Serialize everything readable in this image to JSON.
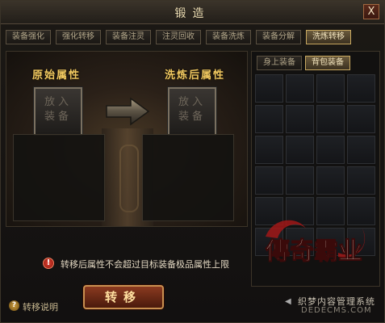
{
  "window": {
    "title": "锻造",
    "close_label": "X"
  },
  "tabs": [
    {
      "label": "装备强化",
      "active": false
    },
    {
      "label": "强化转移",
      "active": false
    },
    {
      "label": "装备注灵",
      "active": false
    },
    {
      "label": "注灵回收",
      "active": false
    },
    {
      "label": "装备洗炼",
      "active": false
    },
    {
      "label": "装备分解",
      "active": false
    },
    {
      "label": "洗炼转移",
      "active": true
    }
  ],
  "left_panel": {
    "orig_label": "原始属性",
    "after_label": "洗炼后属性",
    "orig_slot_text": "放入装备",
    "after_slot_text": "放入装备"
  },
  "right_panel": {
    "subtabs": [
      {
        "label": "身上装备",
        "active": false
      },
      {
        "label": "背包装备",
        "active": true
      }
    ],
    "grid_cells": 24
  },
  "notice": {
    "icon": "!",
    "text": "转移后属性不会超过目标装备极品属性上限"
  },
  "help": {
    "icon": "?",
    "label": "转移说明"
  },
  "transfer_button": "转移",
  "logo": {
    "text": "傳奇霸业"
  },
  "watermark": {
    "line1": "织梦内容管理系统",
    "line2": "DEDECMS.COM"
  },
  "colors": {
    "accent_gold": "#f0c860",
    "button_red": "#8a3a20",
    "active_tab": "#c8a860"
  }
}
